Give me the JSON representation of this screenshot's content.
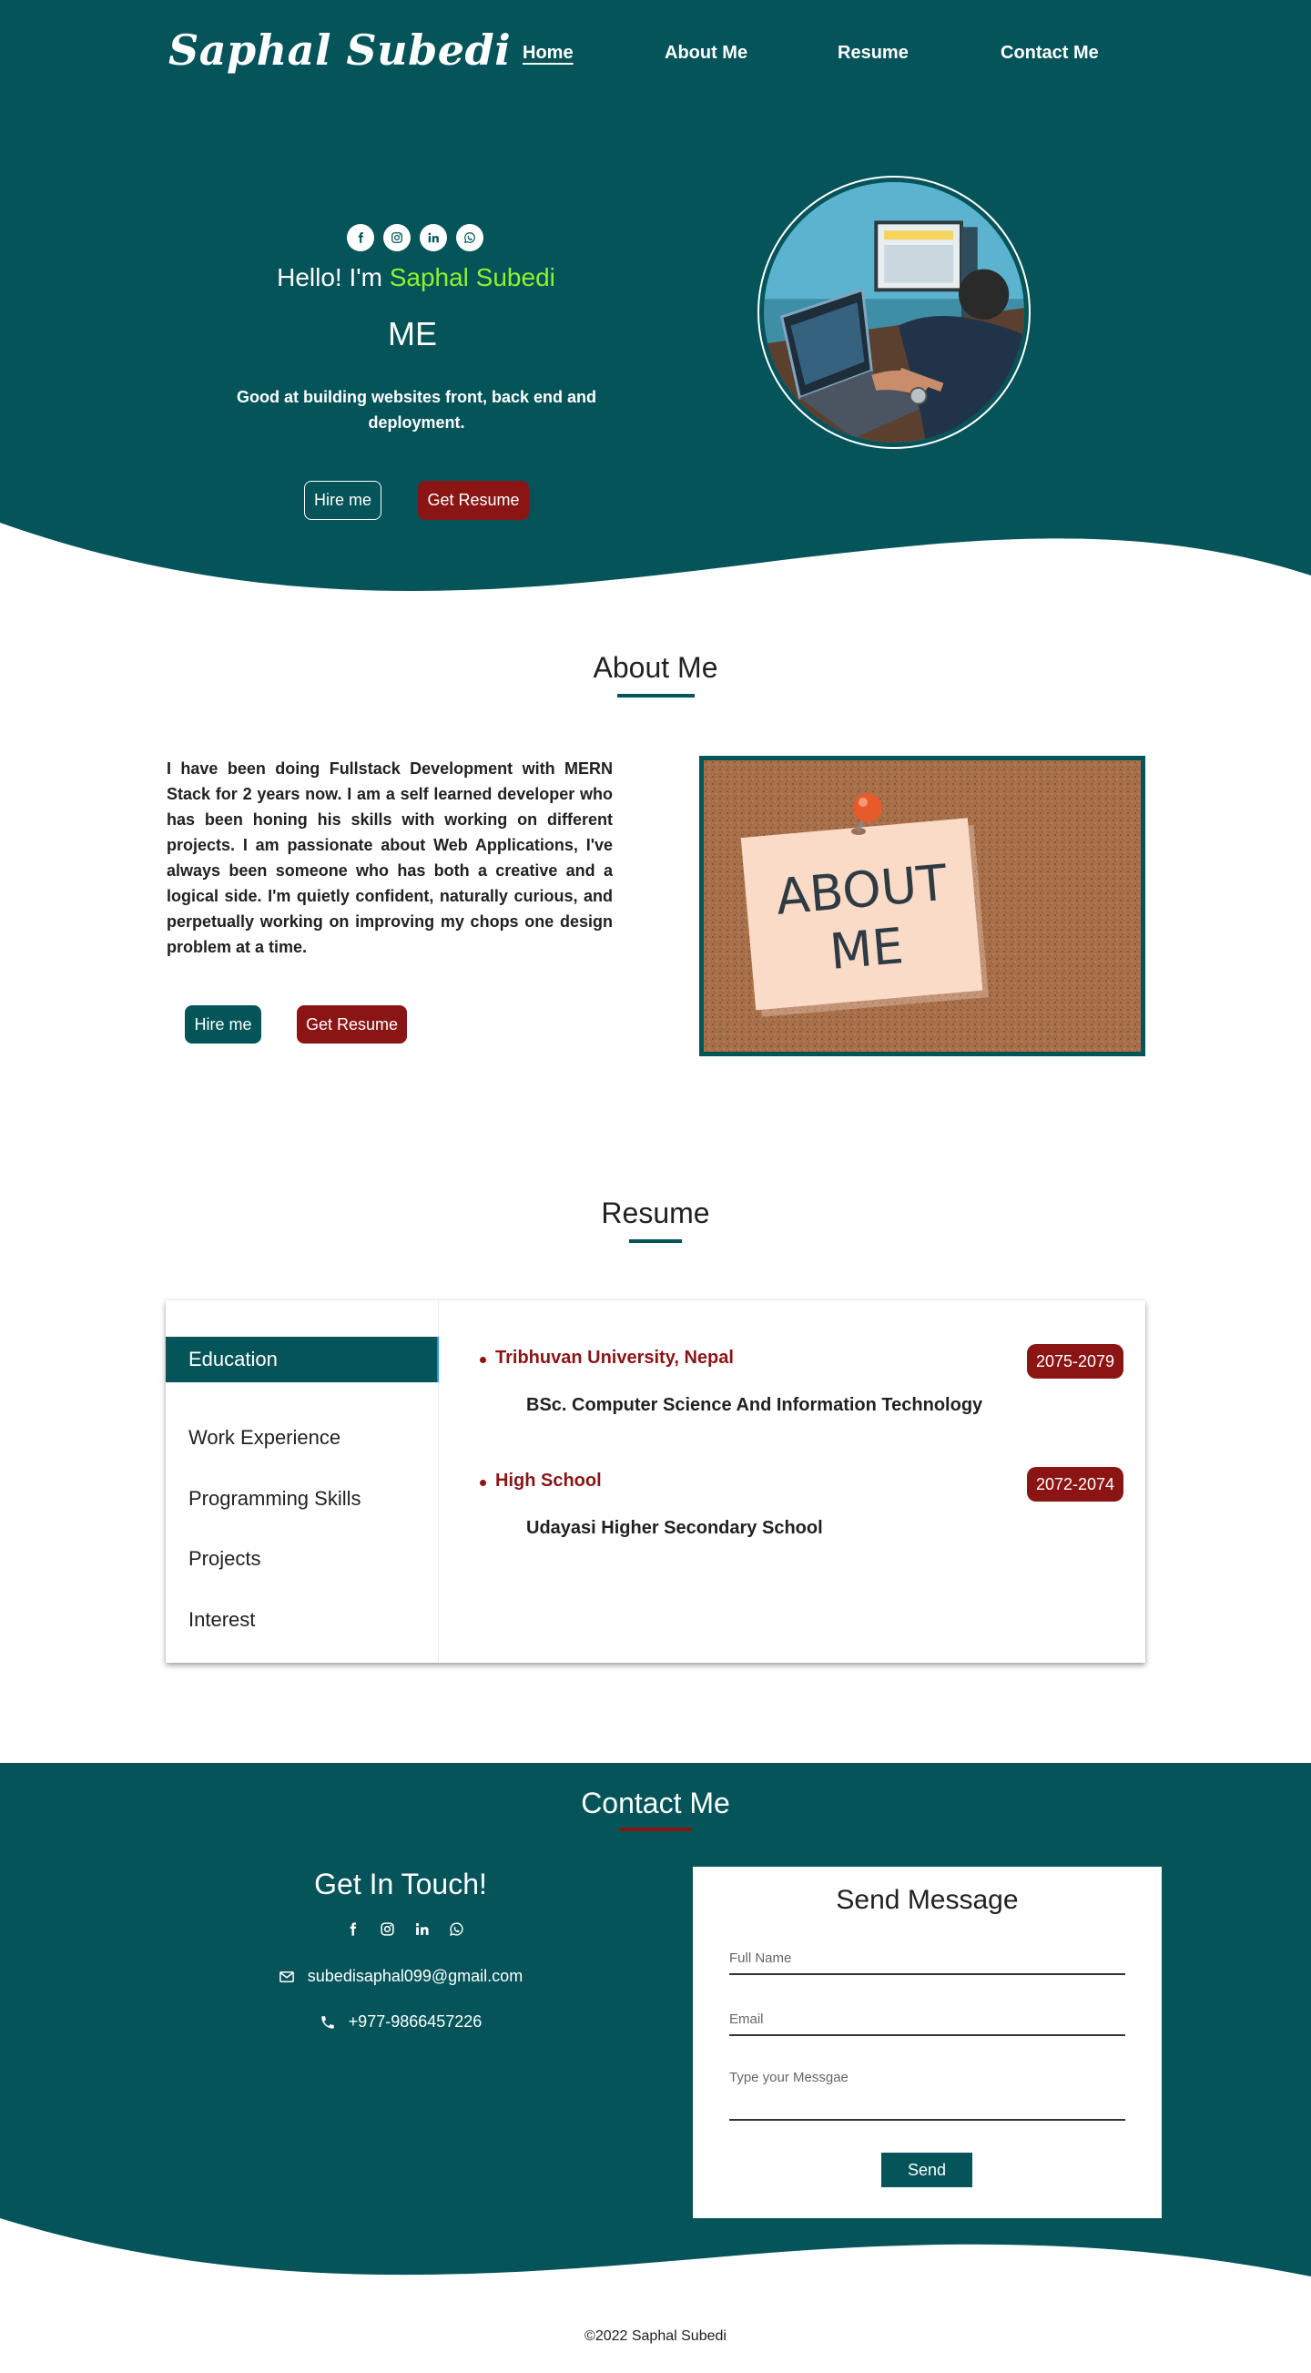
{
  "brand": {
    "name": "Saphal Subedi"
  },
  "nav": {
    "items": [
      {
        "label": "Home",
        "active": true
      },
      {
        "label": "About Me",
        "active": false
      },
      {
        "label": "Resume",
        "active": false
      },
      {
        "label": "Contact Me",
        "active": false
      }
    ]
  },
  "hero": {
    "greeting": "Hello! I'm",
    "name": "Saphal Subedi",
    "role": "ME",
    "tagline": "Good at building websites front, back end and deployment.",
    "hire_label": "Hire me",
    "resume_label": "Get Resume",
    "social_icons": [
      "facebook-icon",
      "instagram-icon",
      "linkedin-icon",
      "whatsapp-icon"
    ]
  },
  "about": {
    "title": "About Me",
    "text": "I have been doing Fullstack Development with MERN Stack for 2 years now. I am a self learned developer who has been honing his skills with working on different projects. I am passionate about Web Applications, I've always been someone who has both a creative and a logical side. I'm quietly confident, naturally curious, and perpetually working on improving my chops one design problem at a time.",
    "hire_label": "Hire me",
    "resume_label": "Get Resume",
    "note_line1": "ABOUT",
    "note_line2": "ME"
  },
  "resume": {
    "title": "Resume",
    "tabs": [
      {
        "label": "Education",
        "active": true
      },
      {
        "label": "Work Experience",
        "active": false
      },
      {
        "label": "Programming Skills",
        "active": false
      },
      {
        "label": "Projects",
        "active": false
      },
      {
        "label": "Interest",
        "active": false
      }
    ],
    "education": [
      {
        "institution": "Tribhuvan University, Nepal",
        "years": "2075-2079",
        "detail": "BSc. Computer Science And Information Technology"
      },
      {
        "institution": "High School",
        "years": "2072-2074",
        "detail": "Udayasi Higher Secondary School"
      }
    ]
  },
  "contact": {
    "title": "Contact Me",
    "get_in_touch": "Get In Touch!",
    "email": "subedisaphal099@gmail.com",
    "phone": "+977-9866457226",
    "form": {
      "title": "Send Message",
      "name_placeholder": "Full Name",
      "email_placeholder": "Email",
      "message_placeholder": "Type your Messgae",
      "send_label": "Send"
    }
  },
  "footer": {
    "copyright": "©2022 Saphal Subedi"
  },
  "colors": {
    "teal": "#04545a",
    "dark_red": "#8b1515",
    "lime": "#8ff22c",
    "white": "#ffffff"
  }
}
